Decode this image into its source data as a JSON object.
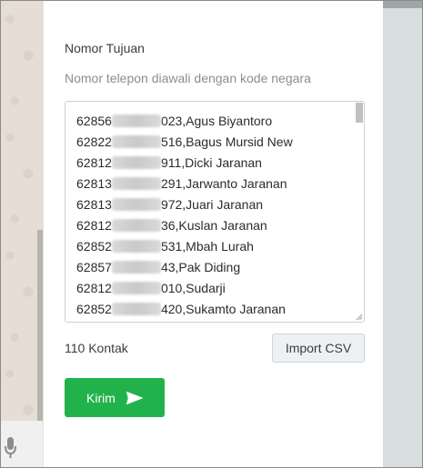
{
  "form": {
    "field_title": "Nomor Tujuan",
    "field_hint": "Nomor telepon diawali dengan kode negara",
    "contacts": [
      {
        "prefix": "62856",
        "suffix": "023,Agus Biyantoro"
      },
      {
        "prefix": "62822",
        "suffix": "516,Bagus Mursid New"
      },
      {
        "prefix": "62812",
        "suffix": "911,Dicki Jaranan"
      },
      {
        "prefix": "62813",
        "suffix": "291,Jarwanto Jaranan"
      },
      {
        "prefix": "62813",
        "suffix": "972,Juari Jaranan"
      },
      {
        "prefix": "62812",
        "suffix": "36,Kuslan Jaranan"
      },
      {
        "prefix": "62852",
        "suffix": "531,Mbah Lurah"
      },
      {
        "prefix": "62857",
        "suffix": "43,Pak Diding"
      },
      {
        "prefix": "62812",
        "suffix": "010,Sudarji"
      },
      {
        "prefix": "62852",
        "suffix": "420,Sukamto Jaranan"
      }
    ],
    "contact_count": "110 Kontak",
    "import_label": "Import CSV",
    "send_label": "Kirim"
  },
  "icons": {
    "send": "send-icon",
    "mic": "mic-icon"
  },
  "colors": {
    "send_button": "#22b24c",
    "import_button": "#eef1f4"
  }
}
